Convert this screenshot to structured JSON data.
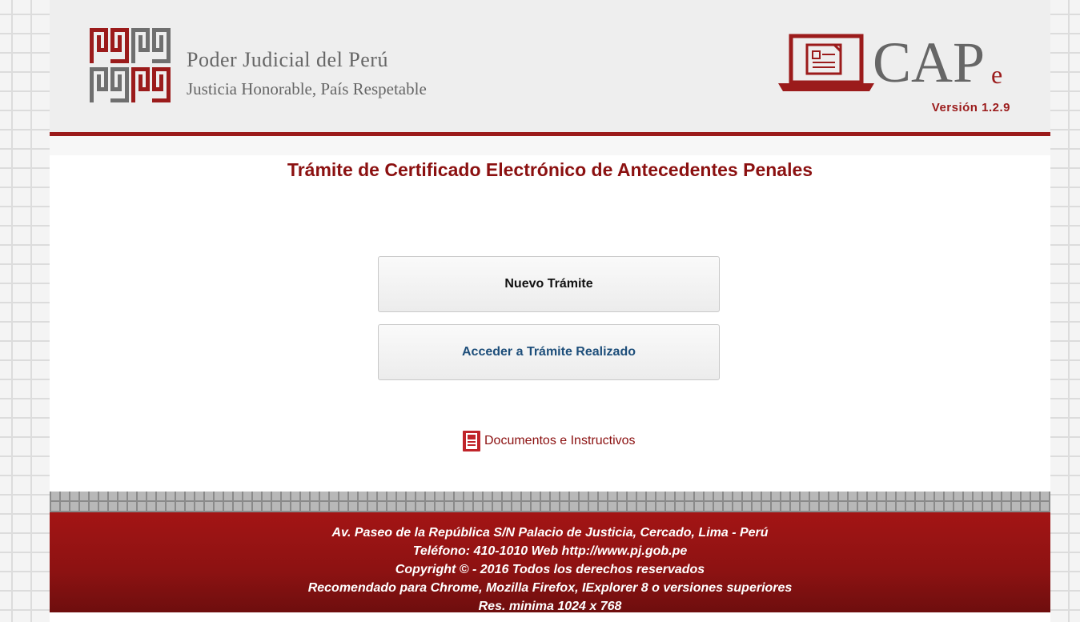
{
  "header": {
    "org_name": "Poder Judicial del Perú",
    "org_motto": "Justicia Honorable, País Respetable",
    "app_logo_main": "CAP",
    "app_logo_suffix": "e",
    "version": "Versión 1.2.9"
  },
  "main": {
    "title": "Trámite de Certificado Electrónico de Antecedentes Penales",
    "buttons": {
      "new_label": "Nuevo Trámite",
      "access_label": "Acceder a Trámite Realizado"
    },
    "docs_link": {
      "label": "Documentos e Instructivos",
      "icon": "document-icon"
    }
  },
  "footer": {
    "lines": [
      "Av. Paseo de la República S/N Palacio de Justicia, Cercado, Lima - Perú",
      "Teléfono: 410-1010 Web http://www.pj.gob.pe",
      "Copyright © - 2016 Todos los derechos reservados",
      "Recomendado para Chrome, Mozilla Firefox, IExplorer 8 o versiones superiores",
      "Res. minima 1024 x 768"
    ]
  },
  "colors": {
    "brand_red": "#9b1b1b",
    "title_red": "#8b1010",
    "logo_gray": "#6f6f6f",
    "link_blue": "#1d4e7a"
  }
}
